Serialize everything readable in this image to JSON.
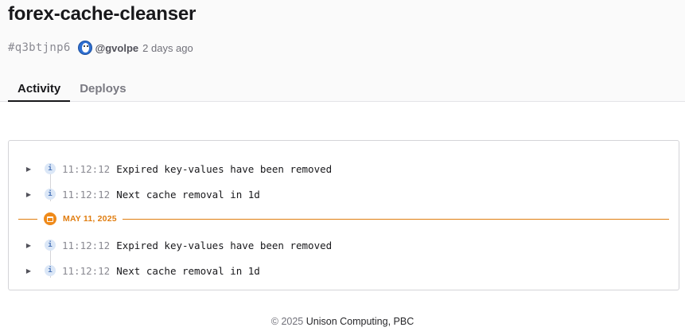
{
  "header": {
    "title": "forex-cache-cleanser",
    "hash": "#q3btjnp6",
    "author": "@gvolpe",
    "time_ago": "2 days ago"
  },
  "tabs": [
    {
      "label": "Activity",
      "active": true
    },
    {
      "label": "Deploys",
      "active": false
    }
  ],
  "log": {
    "group1": [
      {
        "level": "i",
        "time": "11:12:12",
        "message": "Expired key-values have been removed"
      },
      {
        "level": "i",
        "time": "11:12:12",
        "message": "Next cache removal in 1d"
      }
    ],
    "date_divider": "MAY 11, 2025",
    "group2": [
      {
        "level": "i",
        "time": "11:12:12",
        "message": "Expired key-values have been removed"
      },
      {
        "level": "i",
        "time": "11:12:12",
        "message": "Next cache removal in 1d"
      }
    ]
  },
  "footer": {
    "copyright": "© 2025",
    "org": "Unison Computing, PBC"
  },
  "colors": {
    "accent_orange": "#e07d10",
    "info_blue": "#4a74b8"
  }
}
